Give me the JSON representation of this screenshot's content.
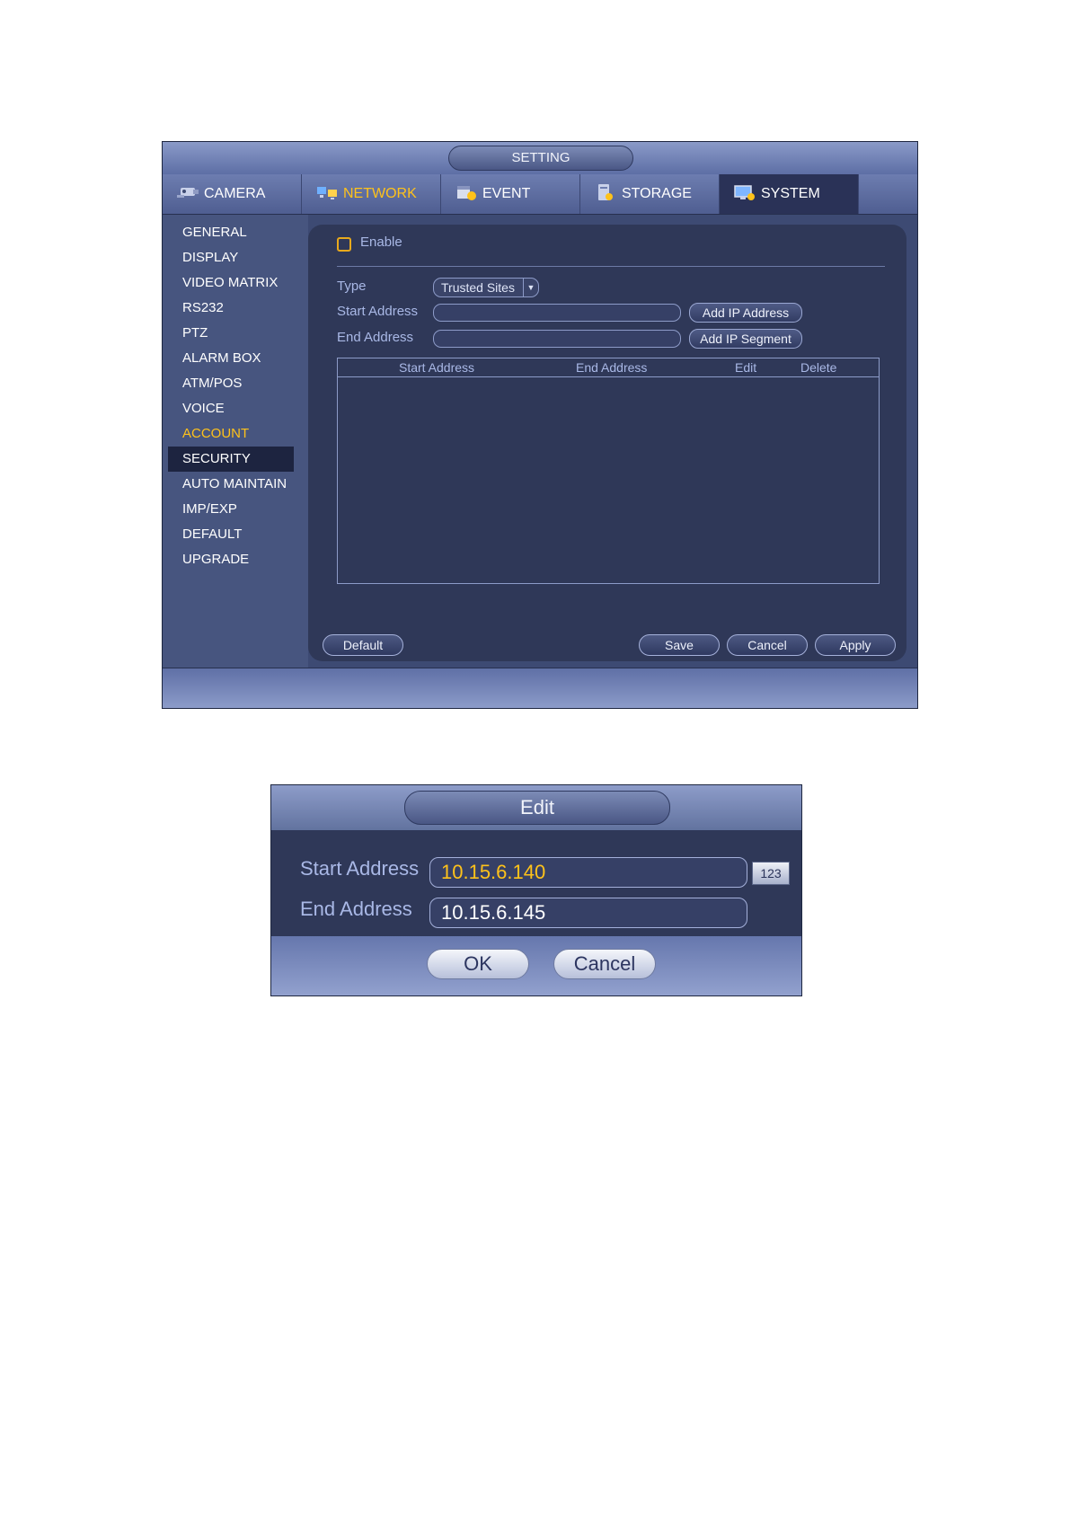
{
  "settings_window": {
    "title": "SETTING",
    "tabs": [
      {
        "label": "CAMERA",
        "icon": "camera-icon"
      },
      {
        "label": "NETWORK",
        "icon": "network-icon"
      },
      {
        "label": "EVENT",
        "icon": "event-icon"
      },
      {
        "label": "STORAGE",
        "icon": "storage-icon"
      },
      {
        "label": "SYSTEM",
        "icon": "system-icon"
      }
    ],
    "sidebar": [
      "GENERAL",
      "DISPLAY",
      "VIDEO MATRIX",
      "RS232",
      "PTZ",
      "ALARM BOX",
      "ATM/POS",
      "VOICE",
      "ACCOUNT",
      "SECURITY",
      "AUTO MAINTAIN",
      "IMP/EXP",
      "DEFAULT",
      "UPGRADE"
    ],
    "form": {
      "enable_label": "Enable",
      "type_label": "Type",
      "type_value": "Trusted Sites",
      "start_label": "Start Address",
      "end_label": "End Address",
      "start_value": "",
      "end_value": "",
      "add_ip_button": "Add IP Address",
      "add_segment_button": "Add IP Segment"
    },
    "table_headers": [
      "Start Address",
      "End Address",
      "Edit",
      "Delete"
    ],
    "buttons": {
      "default": "Default",
      "save": "Save",
      "cancel": "Cancel",
      "apply": "Apply"
    }
  },
  "edit_dialog": {
    "title": "Edit",
    "start_label": "Start Address",
    "start_value": "10.15.6.140",
    "end_label": "End Address",
    "end_value": "10.15.6.145",
    "keyboard_button": "123",
    "ok": "OK",
    "cancel": "Cancel"
  },
  "colors": {
    "accent": "#ffc21a",
    "panel": "#2f3858",
    "window": "#3d4a73",
    "label": "#a9b8e6"
  }
}
